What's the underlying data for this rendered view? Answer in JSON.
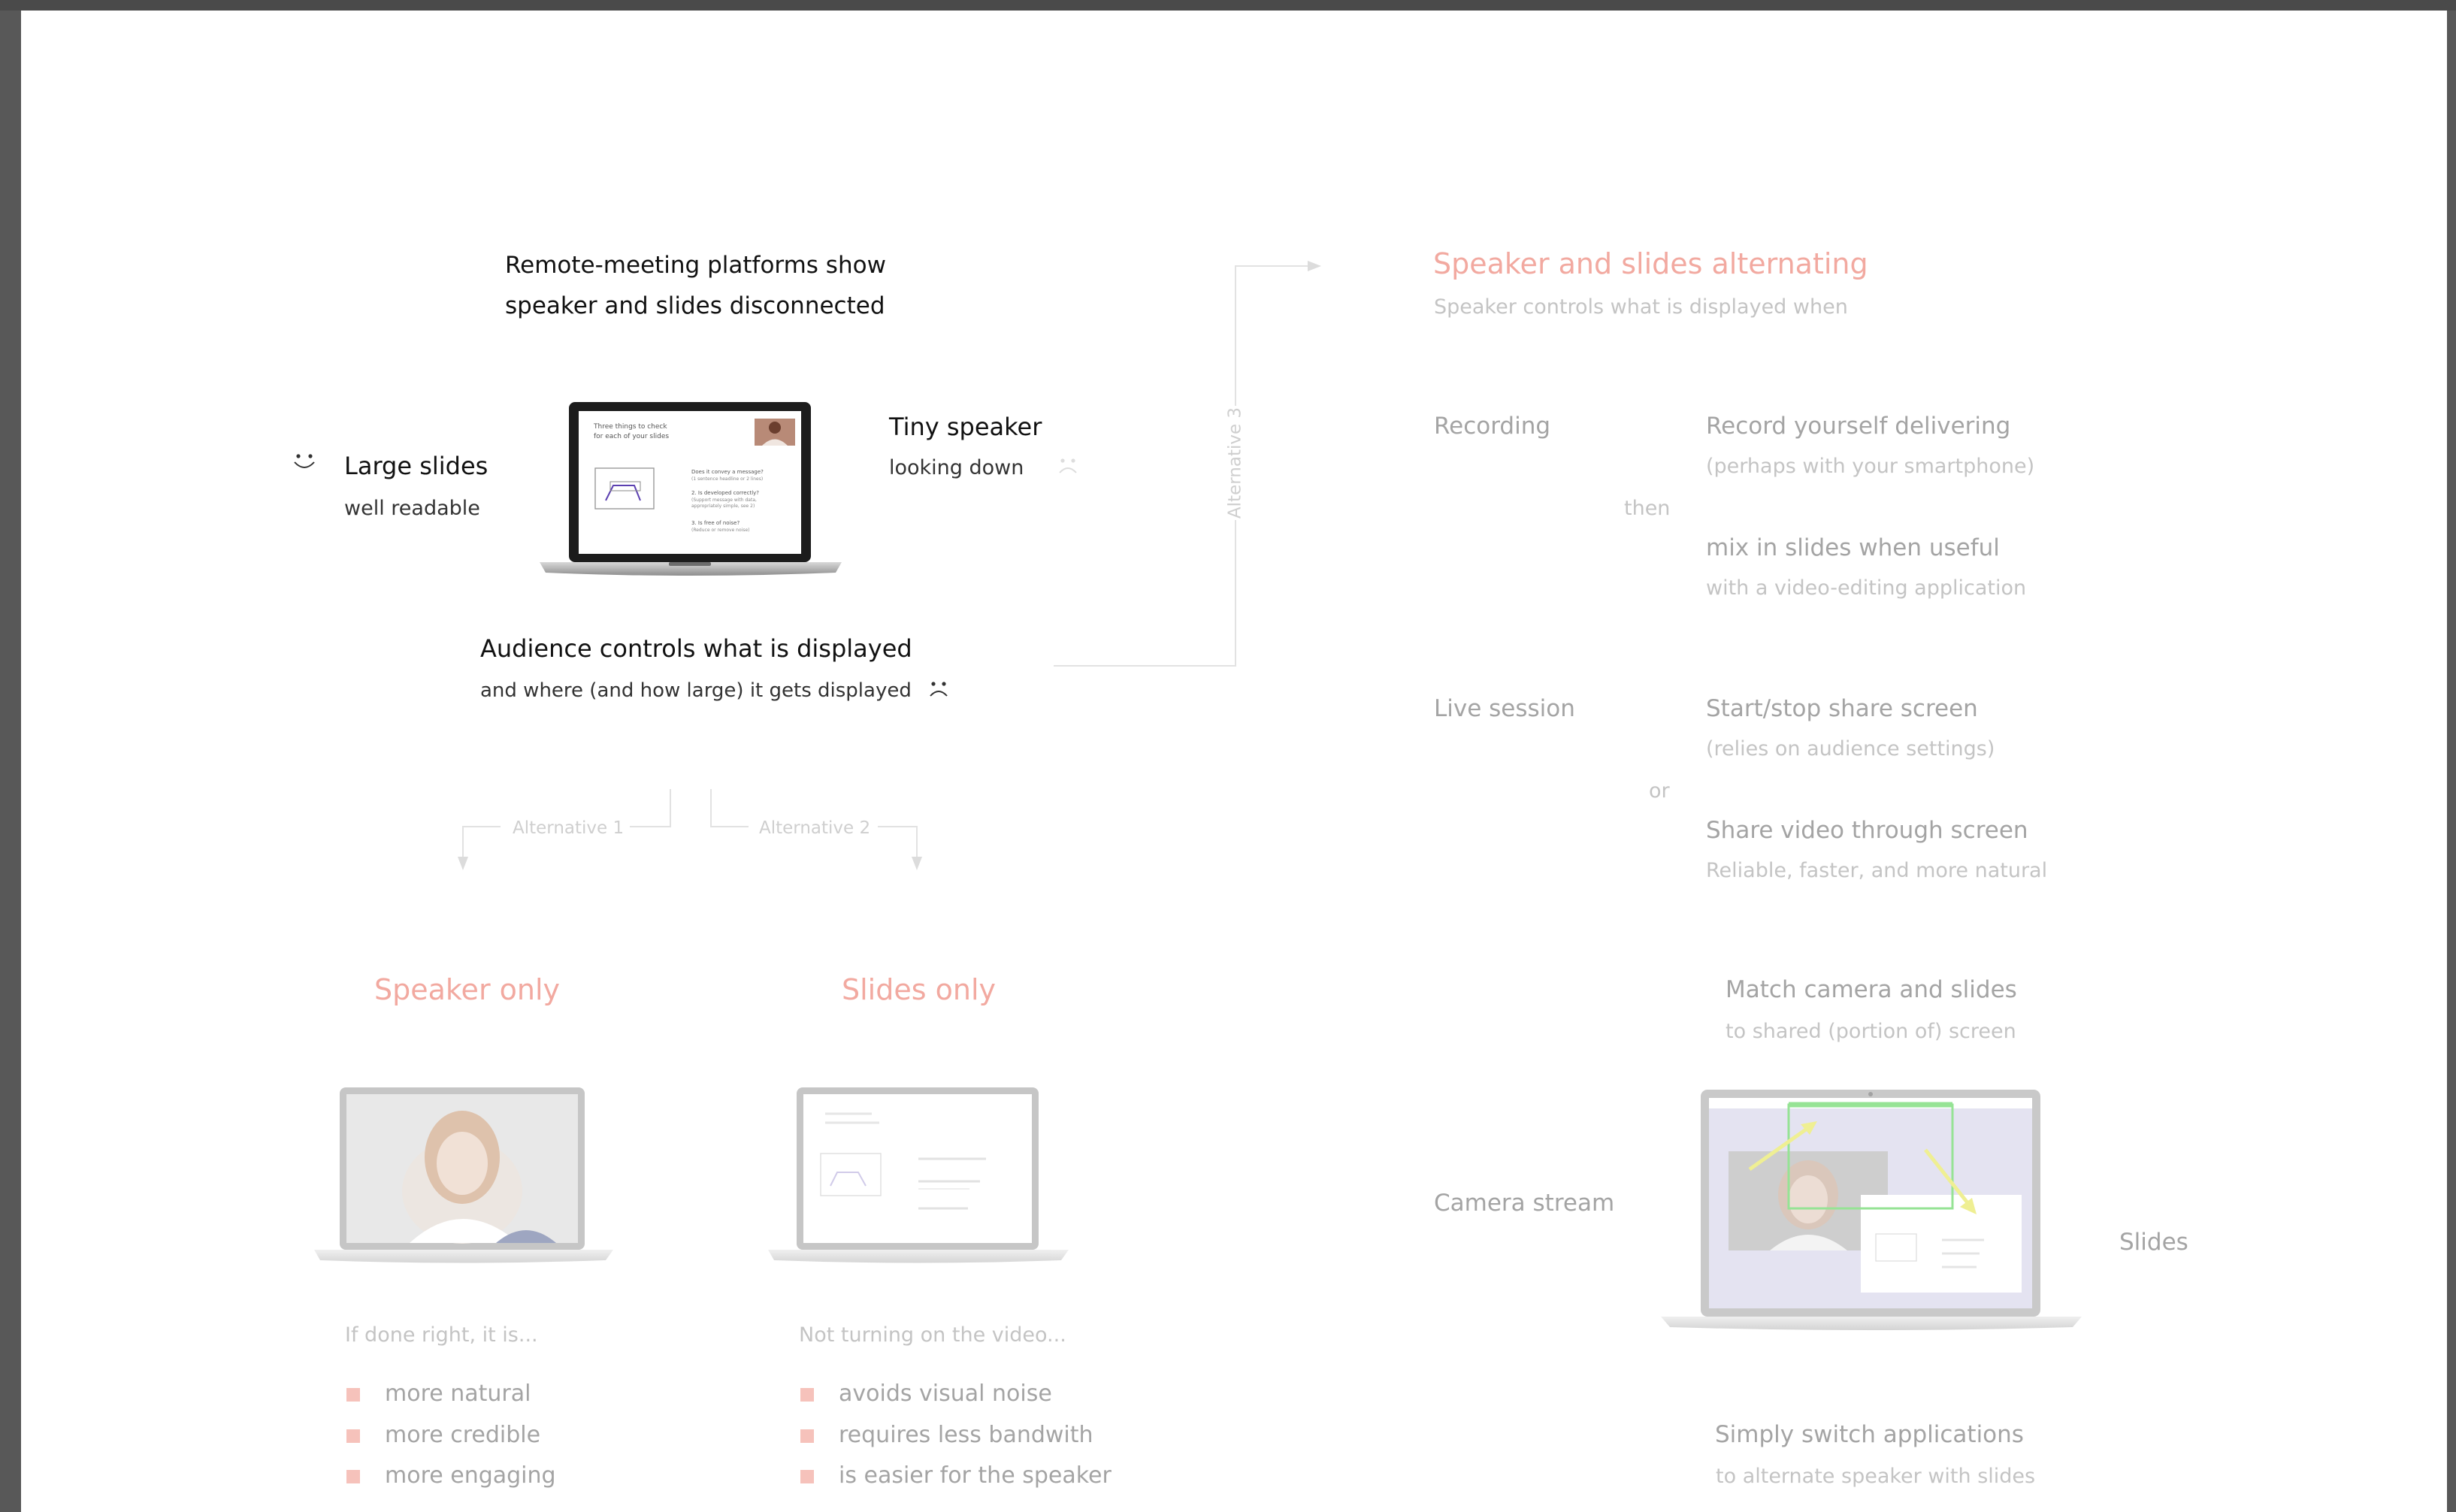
{
  "top": {
    "title_line1": "Remote-meeting platforms show",
    "title_line2": "speaker and slides disconnected",
    "large_slides": "Large slides",
    "well_readable": "well readable",
    "tiny_speaker": "Tiny speaker",
    "looking_down": "looking down",
    "audience_controls": "Audience controls what is displayed",
    "audience_sub": "and where (and how large) it gets displayed"
  },
  "mini_slide": {
    "heading_line1": "Three things to check",
    "heading_line2": "for each of your slides",
    "item1": "Does it convey a message?",
    "item1_sub": "(1 sentence headline or 2 lines)",
    "item2": "2. Is developed correctly?",
    "item2_sub": "(Support message with data, appropriately simple, see 2)",
    "item3": "3. Is free of noise?",
    "item3_sub": "(Reduce or remove noise)"
  },
  "alternatives": {
    "alt1": "Alternative 1",
    "alt2": "Alternative 2",
    "alt3": "Alternative 3"
  },
  "speaker_only": {
    "title": "Speaker only",
    "intro": "If done right, it is...",
    "bullets": [
      "more natural",
      "more credible",
      "more engaging"
    ]
  },
  "slides_only": {
    "title": "Slides only",
    "intro": "Not turning on the video...",
    "bullets": [
      "avoids visual noise",
      "requires less bandwith",
      "is easier for the speaker"
    ]
  },
  "alternating": {
    "title": "Speaker and slides alternating",
    "subtitle": "Speaker controls what is displayed when",
    "recording_label": "Recording",
    "rec_item1": "Record yourself delivering",
    "rec_item1_sub": "(perhaps with your smartphone)",
    "then": "then",
    "rec_item2": "mix in slides when useful",
    "rec_item2_sub": "with a video-editing application",
    "live_label": "Live session",
    "live_item1": "Start/stop share screen",
    "live_item1_sub": "(relies on audience settings)",
    "or": "or",
    "live_item2": "Share video through screen",
    "live_item2_sub": "Reliable, faster, and more natural",
    "match_title": "Match camera and slides",
    "match_sub": "to shared (portion of) screen",
    "camera_stream": "Camera stream",
    "slides_label": "Slides",
    "switch_title": "Simply switch applications",
    "switch_sub": "to alternate speaker with slides"
  },
  "colors": {
    "accent_pink": "#f2a9a0",
    "bullet": "#f6c2bb",
    "green_highlight": "#8be08a",
    "arrow_yellow": "#eeee88",
    "screen_lavender": "#e2e0f0"
  },
  "icons": {
    "smile": "smile-icon",
    "frown": "frown-icon"
  }
}
